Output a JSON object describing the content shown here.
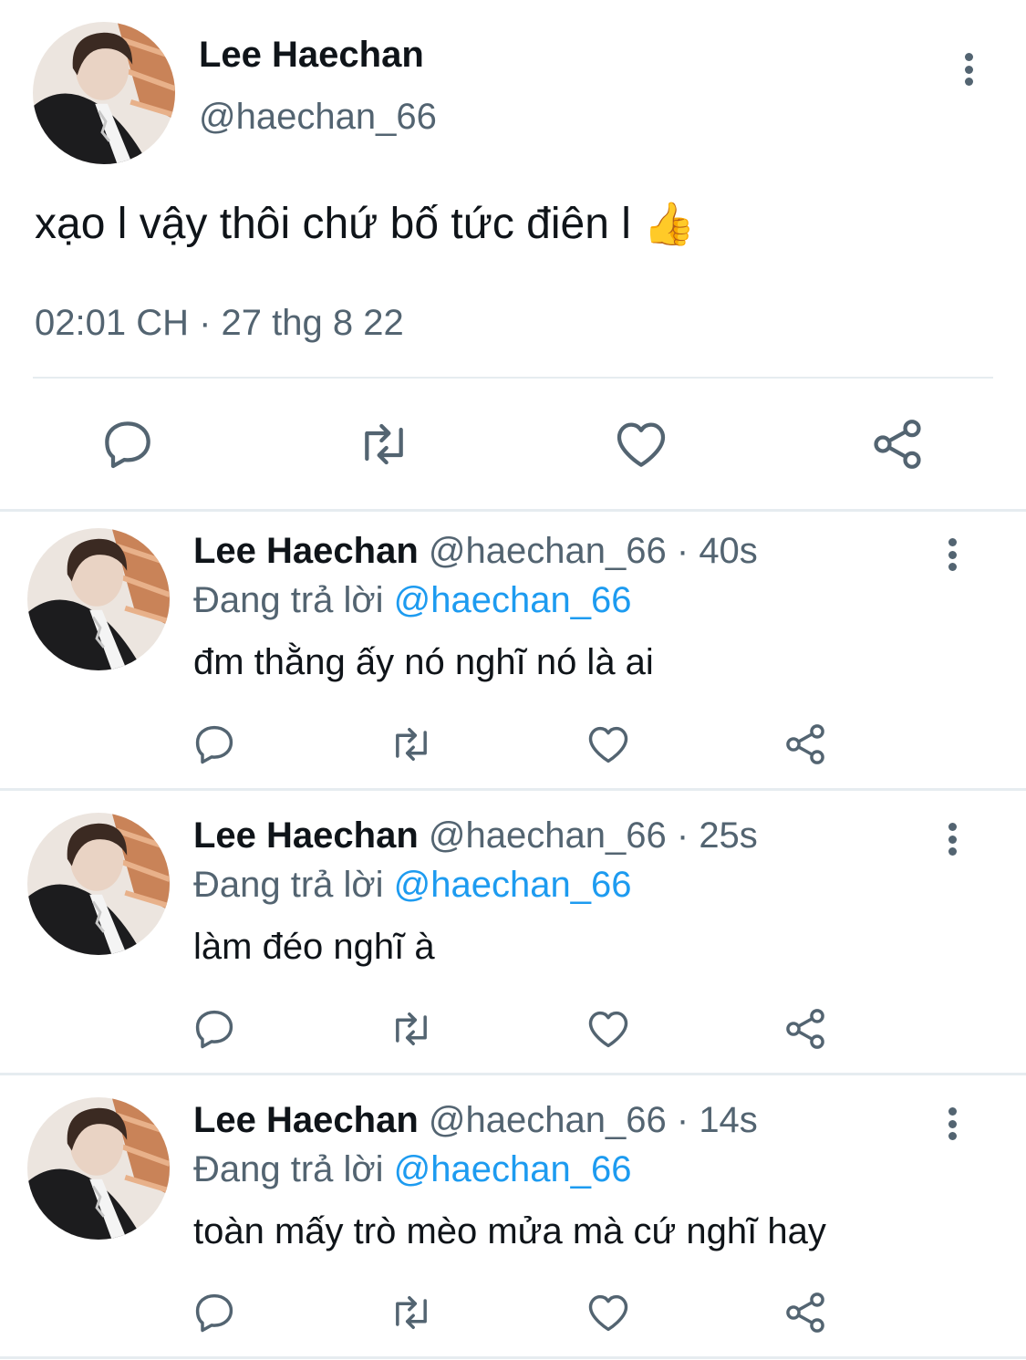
{
  "main_tweet": {
    "name": "Lee Haechan",
    "handle": "@haechan_66",
    "text": "xạo l vậy thôi chứ bố tức điên l",
    "emoji": "👍",
    "timestamp": "02:01 CH · 27 thg 8 22",
    "actions": [
      "reply-icon",
      "retweet-icon",
      "like-icon",
      "share-icon"
    ]
  },
  "replies": [
    {
      "name": "Lee Haechan",
      "handle": "@haechan_66",
      "time": "40s",
      "replying_prefix": "Đang trả lời",
      "replying_to": "@haechan_66",
      "text": "đm thằng ấy nó nghĩ nó là ai"
    },
    {
      "name": "Lee Haechan",
      "handle": "@haechan_66",
      "time": "25s",
      "replying_prefix": "Đang trả lời",
      "replying_to": "@haechan_66",
      "text": "làm đéo nghĩ à"
    },
    {
      "name": "Lee Haechan",
      "handle": "@haechan_66",
      "time": "14s",
      "replying_prefix": "Đang trả lời",
      "replying_to": "@haechan_66",
      "text": "toàn mấy trò mèo mửa mà cứ nghĩ hay"
    }
  ],
  "colors": {
    "text": "#0f1419",
    "secondary": "#536471",
    "accent": "#1d9bf0",
    "divider": "#e6ecf0"
  }
}
